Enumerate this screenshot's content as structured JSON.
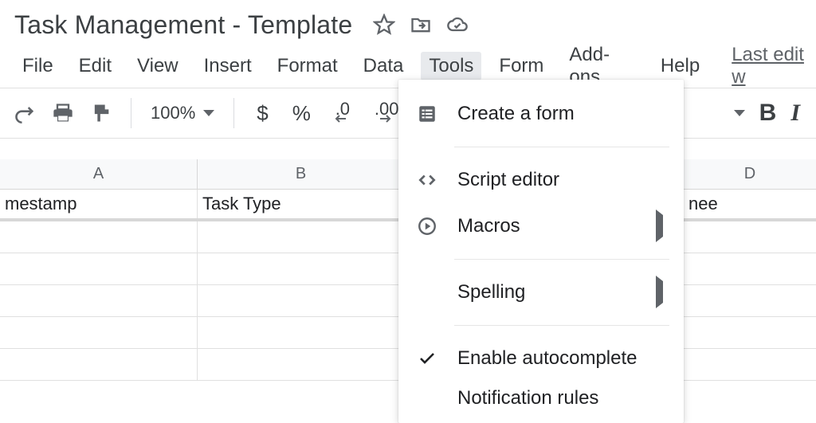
{
  "doc": {
    "title": "Task Management - Template"
  },
  "menubar": {
    "items": [
      "File",
      "Edit",
      "View",
      "Insert",
      "Format",
      "Data",
      "Tools",
      "Form",
      "Add-ons",
      "Help"
    ],
    "active": "Tools",
    "last_edit": "Last edit w"
  },
  "toolbar": {
    "zoom": "100%",
    "currency": "$",
    "percent": "%",
    "dec_dec": ".0",
    "inc_dec": ".00",
    "bold": "B",
    "italic": "I"
  },
  "grid": {
    "columns": [
      "A",
      "B",
      "",
      "D"
    ],
    "row1": {
      "a": "mestamp",
      "b": "Task Type",
      "c": "",
      "d": "nee"
    }
  },
  "tools_menu": {
    "create_form": "Create a form",
    "script_editor": "Script editor",
    "macros": "Macros",
    "spelling": "Spelling",
    "enable_autocomplete": "Enable autocomplete",
    "notification_rules": "Notification rules"
  }
}
